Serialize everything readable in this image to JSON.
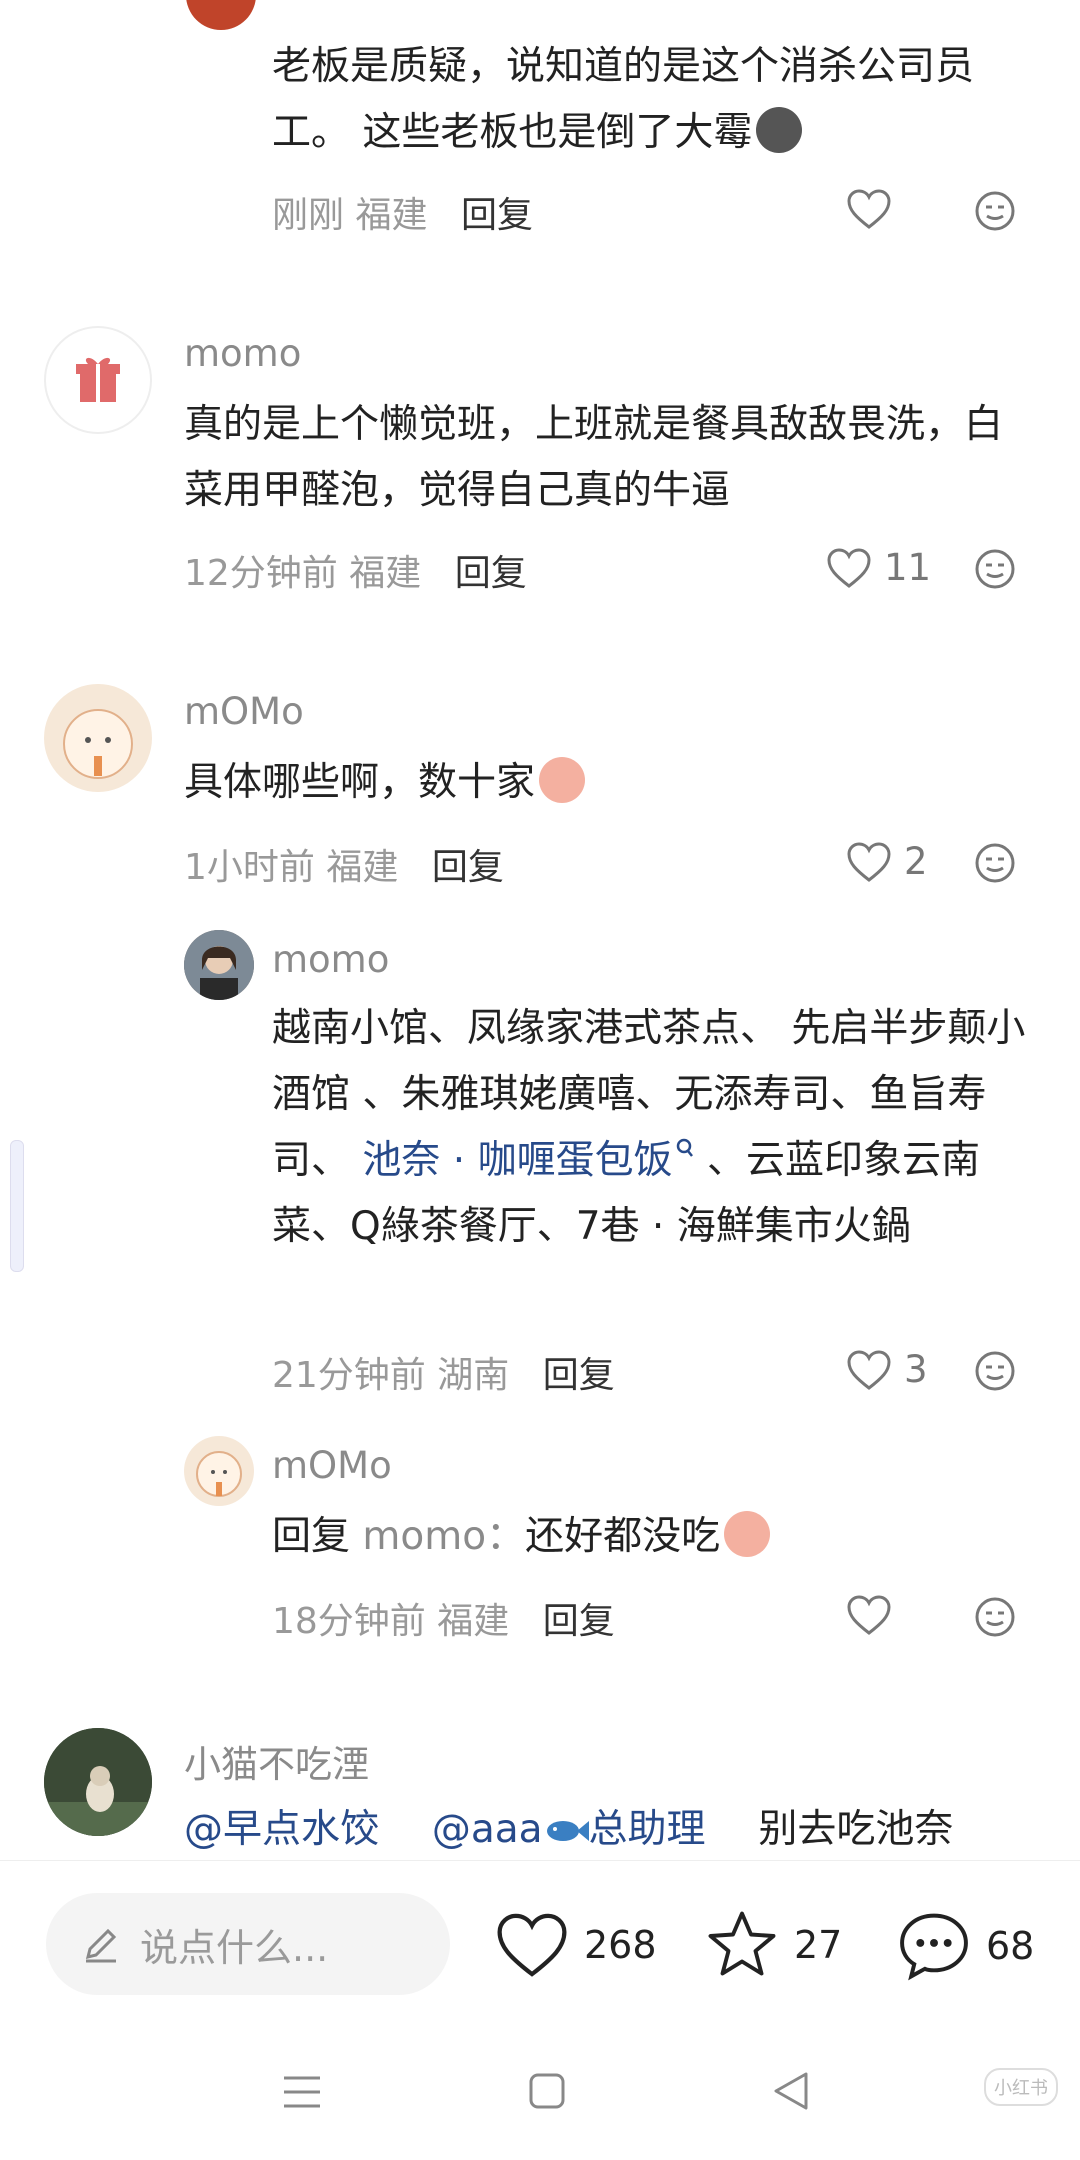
{
  "comments": [
    {
      "id": "c0",
      "text": "老板是质疑，说知道的是这个消杀公司员工。 这些老板也是倒了大霉",
      "time": "刚刚",
      "location": "福建",
      "reply_label": "回复",
      "likes": ""
    },
    {
      "id": "c1",
      "name": "momo",
      "text": "真的是上个懒觉班，上班就是餐具敌敌畏洗，白菜用甲醛泡，觉得自己真的牛逼",
      "time": "12分钟前",
      "location": "福建",
      "reply_label": "回复",
      "likes": "11"
    },
    {
      "id": "c2",
      "name": "mOMo",
      "text": "具体哪些啊，数十家",
      "time": "1小时前",
      "location": "福建",
      "reply_label": "回复",
      "likes": "2"
    },
    {
      "id": "c3",
      "name": "momo",
      "text_before_link": "越南小馆、凤缘家港式茶点、 先启半步颠小酒馆 、朱雅琪姥廣嘻、无添寿司、鱼旨寿司、 ",
      "link": "池奈 · 咖喱蛋包饭",
      "text_after_link": " 、云蓝印象云南菜、Q綠茶餐厅、7巷 · 海鮮集市火鍋",
      "time": "21分钟前",
      "location": "湖南",
      "reply_label": "回复",
      "likes": "3"
    },
    {
      "id": "c4",
      "name": "mOMo",
      "reply_prefix": "回复",
      "reply_to": "momo：",
      "text": "还好都没吃",
      "time": "18分钟前",
      "location": "福建",
      "reply_label": "回复",
      "likes": ""
    },
    {
      "id": "c5",
      "name": "小猫不吃湮",
      "mention1": "@早点水饺",
      "mention2": "@aaa",
      "mention2_suffix": "总助理",
      "text": "别去吃池奈"
    }
  ],
  "bottom": {
    "input_placeholder": "说点什么...",
    "likes": "268",
    "stars": "27",
    "comments": "68"
  },
  "watermark": "小红书",
  "colors": {
    "link": "#274a8a",
    "meta": "#999999",
    "name": "#8a8a8a"
  }
}
